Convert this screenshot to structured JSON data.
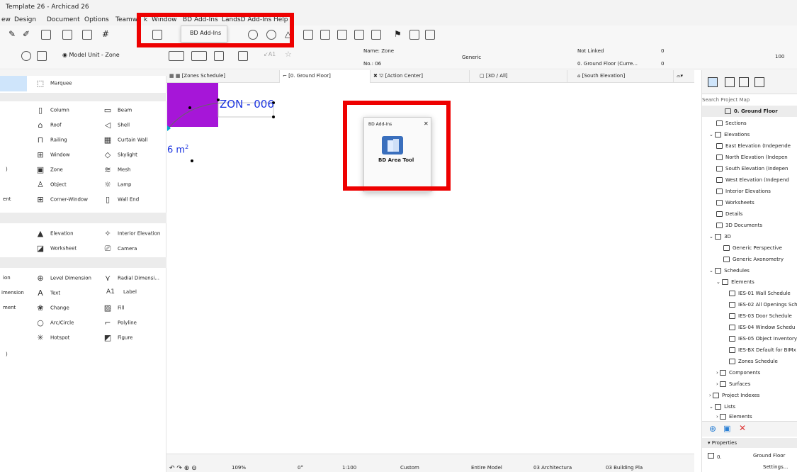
{
  "app": {
    "title": "Template 26 - Archicad 26"
  },
  "menu": [
    "ew",
    "Design",
    "Document",
    "Options",
    "Teamw",
    "k",
    "Window",
    "BD Add-Ins",
    "LandsD Add-Ins",
    "Help"
  ],
  "dropdown": {
    "item": "BD Add-Ins"
  },
  "infobox": {
    "layer_label": "Model Unit - Zone",
    "name_label": "Name: Zone",
    "no_label": "No.: 06",
    "category": "Generic",
    "link_status": "Not Linked",
    "floor_value": "0. Ground Floor (Curre...",
    "value_0a": "0",
    "value_0b": "0",
    "scale_value": "100"
  },
  "tabs": [
    "[Zones Schedule]",
    "[0. Ground Floor]",
    "[Action Center]",
    "[3D / All]",
    "[South Elevation]"
  ],
  "toolbox": {
    "marquee": "Marquee",
    "design_left": [
      "Column",
      "Roof",
      "Railing",
      "Window",
      "Zone",
      "Object",
      "Corner-Window"
    ],
    "design_right": [
      "Beam",
      "Shell",
      "Curtain Wall",
      "Skylight",
      "Mesh",
      "Lamp",
      "Wall End"
    ],
    "view_left": [
      "Elevation",
      "Worksheet"
    ],
    "view_right": [
      "Interior Elevation",
      "Camera"
    ],
    "doc_left": [
      "Level Dimension",
      "Text",
      "Change",
      "Arc/Circle",
      "Hotspot"
    ],
    "doc_right": [
      "Radial Dimensi...",
      "Label",
      "Fill",
      "Polyline",
      "Figure"
    ],
    "cut_left": [
      ")",
      "ent",
      "ion",
      "imension",
      "ment",
      ")"
    ],
    "label_glyph": "A1"
  },
  "canvas": {
    "zone_label": "ZON - 006",
    "area_label": "6 m",
    "area_sup": "2"
  },
  "palette": {
    "title": "BD Add-Ins",
    "close": "✕",
    "tool_label": "BD Area Tool"
  },
  "status": {
    "zoom": "109%",
    "angle": "0°",
    "scale": "1:100",
    "pen_set": "Custom",
    "model_view": "Entire Model",
    "layer_combo": "03 Architectura",
    "dim_std": "03 Building Pla"
  },
  "navigator": {
    "search_placeholder": "Search Project Map",
    "items": [
      "0. Ground Floor",
      "Sections",
      "Elevations",
      "East Elevation (Independe",
      "North Elevation (Indepen",
      "South Elevation (Indepen",
      "West Elevation (Independ",
      "Interior Elevations",
      "Worksheets",
      "Details",
      "3D Documents",
      "3D",
      "Generic Perspective",
      "Generic Axonometry",
      "Schedules",
      "Elements",
      "IES-01 Wall Schedule",
      "IES-02 All Openings Sch",
      "IES-03 Door Schedule",
      "IES-04 Window Schedu",
      "IES-05 Object Inventory",
      "IES-BX Default for BIMx",
      "Zones Schedule",
      "Components",
      "Surfaces",
      "Project Indexes",
      "Lists",
      "Elements"
    ],
    "properties_header": "Properties",
    "properties_id": "0.",
    "properties_value": "Ground Floor",
    "settings": "Settings..."
  }
}
